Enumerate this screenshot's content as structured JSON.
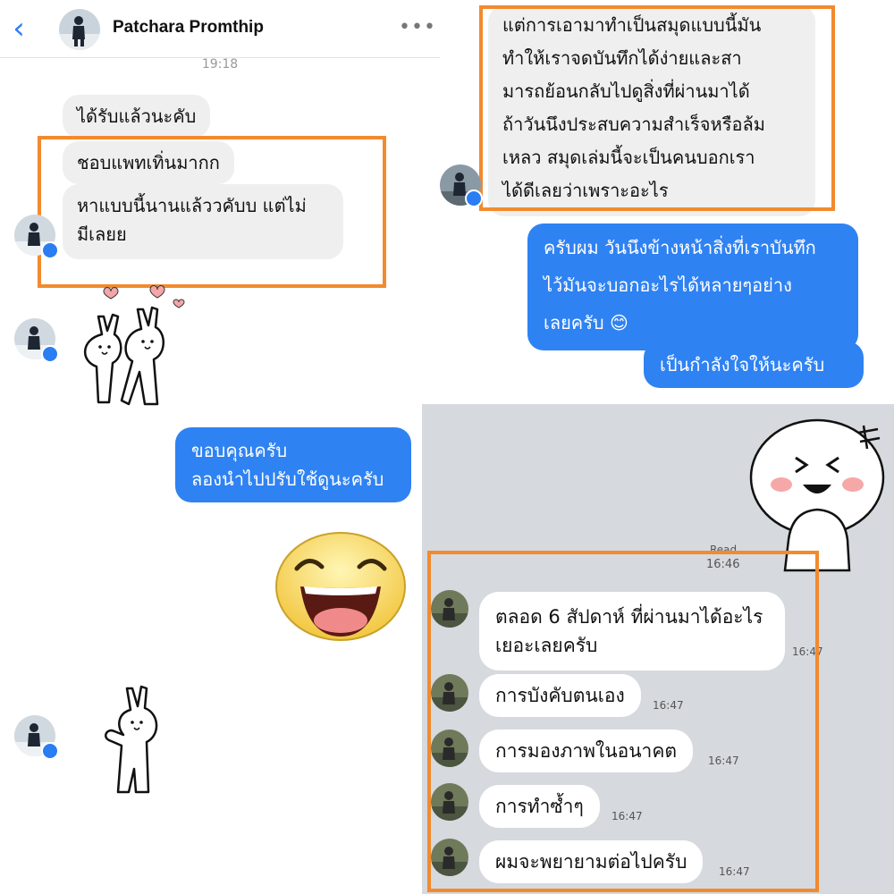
{
  "messenger": {
    "contact_name": "Patchara Promthip",
    "time_separator": "19:18",
    "messages": [
      "ได้รับแล้วนะคับ",
      "ชอบแพทเทิ่นมากก",
      "หาแบบนี้นานแล้ววคับบ แต่ไม่",
      "มีเลยย"
    ],
    "reply_line1": "ขอบคุณครับ",
    "reply_line2": "ลองนำไปปรับใช้ดูนะครับ"
  },
  "right_top": {
    "received_lines": [
      "แต่การเอามาทำเป็นสมุดแบบนี้มัน",
      "ทำให้เราจดบันทึกได้ง่ายและสา",
      "มารถย้อนกลับไปดูสิ่งที่ผ่านมาได้",
      "ถ้าวันนึงประสบความสำเร็จหรือล้ม",
      "เหลว สมุดเล่มนี้จะเป็นคนบอกเรา",
      "ได้ดีเลยว่าเพราะอะไร"
    ],
    "sent_lines": [
      "ครับผม วันนึงข้างหน้าสิ่งที่เราบันทึก",
      "ไว้มันจะบอกอะไรได้หลายๆอย่าง",
      "เลยครับ 😊"
    ],
    "sent_short": "เป็นกำลังใจให้นะครับ"
  },
  "line_chat": {
    "read_label": "Read",
    "read_time": "16:46",
    "messages": [
      {
        "line1": "ตลอด 6 สัปดาห์ ที่ผ่านมาได้อะไร",
        "line2": "เยอะเลยครับ",
        "time": "16:47"
      },
      {
        "line1": "การบังคับตนเอง",
        "time": "16:47"
      },
      {
        "line1": "การมองภาพในอนาคต",
        "time": "16:47"
      },
      {
        "line1": "การทำซ้ำๆ",
        "time": "16:47"
      },
      {
        "line1": "ผมจะพยายามต่อไปครับ",
        "time": "16:47"
      }
    ]
  },
  "icons": {
    "back": "chevron-left-icon",
    "more": "more-dots-icon",
    "badge": "messenger-badge-icon"
  },
  "colors": {
    "messenger_blue": "#2f82f2",
    "bubble_gray": "#efefef",
    "highlight_orange": "#f28a2e",
    "line_bg": "#d6d9de"
  }
}
